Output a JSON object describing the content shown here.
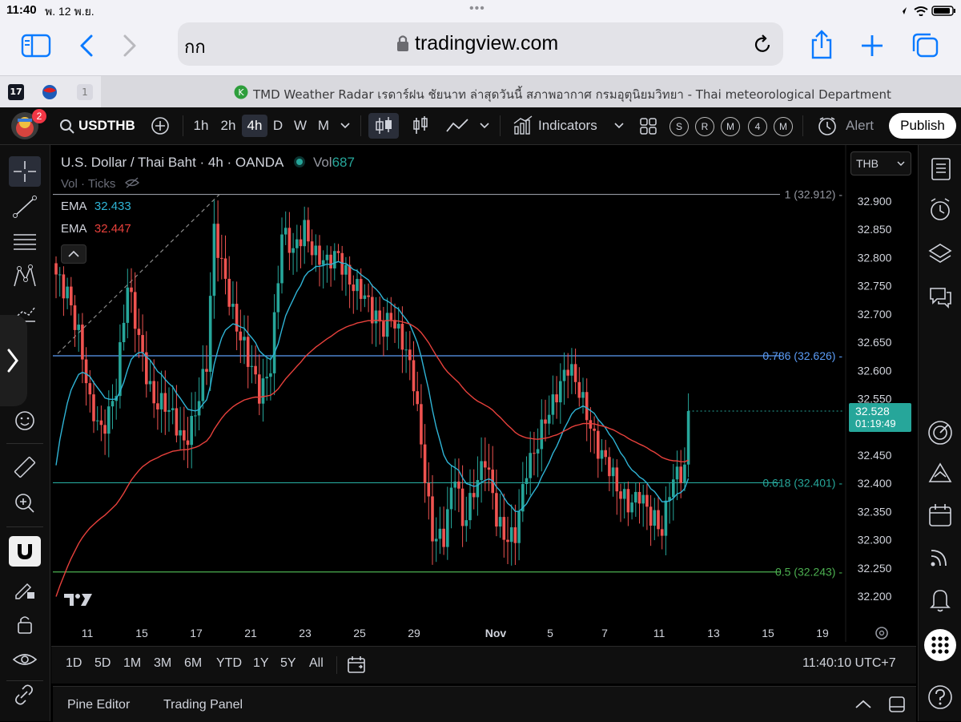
{
  "status": {
    "time": "11:40",
    "date": "พ. 12 พ.ย."
  },
  "safari": {
    "aa": "กก",
    "url": "tradingview.com"
  },
  "tabbar": {
    "tab_count": "1",
    "page_title": "TMD Weather Radar เรดาร์ฝน ชัยนาท ล่าสุดวันนี้ สภาพอากาศ กรมอุตุนิยมวิทยา - Thai meteorological Department"
  },
  "header": {
    "avatar_badge": "2",
    "symbol": "USDTHB",
    "intervals": [
      "1h",
      "2h",
      "4h",
      "D",
      "W",
      "M"
    ],
    "active_interval": "4h",
    "indicators": "Indicators",
    "badges": [
      "S",
      "R",
      "M",
      "4",
      "M"
    ],
    "alert": "Alert",
    "publish": "Publish"
  },
  "legend": {
    "title": "U.S. Dollar / Thai Baht · 4h · OANDA",
    "vol_label": "Vol",
    "vol_value": "687",
    "vol_ticks": "Vol · Ticks",
    "ema1_label": "EMA",
    "ema1_value": "32.433",
    "ema2_label": "EMA",
    "ema2_value": "32.447",
    "currency": "THB"
  },
  "price_badge": {
    "price": "32.528",
    "countdown": "01:19:49"
  },
  "bottom": {
    "ranges": [
      "1D",
      "5D",
      "1M",
      "3M",
      "6M",
      "YTD",
      "1Y",
      "5Y",
      "All"
    ],
    "clock": "11:40:10 UTC+7"
  },
  "panel": {
    "pine": "Pine Editor",
    "trading": "Trading Panel"
  },
  "colors": {
    "up": "#26a69a",
    "down": "#ef5350",
    "ema_fast": "#2fb4d6",
    "ema_slow": "#e8413c",
    "fib_1": "#9598a1",
    "fib_786": "#5b9cf6",
    "fib_618": "#26a69a",
    "fib_5": "#4caf50",
    "bg": "#000000"
  },
  "chart_data": {
    "type": "candlestick",
    "ylim": [
      32.2,
      32.92
    ],
    "y_ticks": [
      "32.900",
      "32.850",
      "32.800",
      "32.750",
      "32.700",
      "32.650",
      "32.600",
      "32.550",
      "32.500",
      "32.450",
      "32.400",
      "32.350",
      "32.300",
      "32.250",
      "32.200"
    ],
    "x_ticks": [
      "11",
      "15",
      "17",
      "21",
      "23",
      "25",
      "29",
      "Nov",
      "5",
      "7",
      "11",
      "13",
      "15",
      "19"
    ],
    "fib_levels": [
      {
        "label": "1 (32.912)",
        "value": 32.912
      },
      {
        "label": "0.786 (32.626)",
        "value": 32.626
      },
      {
        "label": "0.618 (32.401)",
        "value": 32.401
      },
      {
        "label": "0.5 (32.243)",
        "value": 32.243
      }
    ],
    "last_price": 32.528,
    "anchors": [
      [
        0,
        32.77
      ],
      [
        3,
        32.75
      ],
      [
        6,
        32.66
      ],
      [
        9,
        32.53
      ],
      [
        12,
        32.5
      ],
      [
        16,
        32.57
      ],
      [
        19,
        32.74
      ],
      [
        22,
        32.66
      ],
      [
        26,
        32.55
      ],
      [
        30,
        32.52
      ],
      [
        34,
        32.48
      ],
      [
        37,
        32.53
      ],
      [
        40,
        32.6
      ],
      [
        42,
        32.84
      ],
      [
        45,
        32.77
      ],
      [
        48,
        32.68
      ],
      [
        51,
        32.61
      ],
      [
        54,
        32.56
      ],
      [
        57,
        32.62
      ],
      [
        60,
        32.84
      ],
      [
        63,
        32.8
      ],
      [
        66,
        32.86
      ],
      [
        69,
        32.81
      ],
      [
        72,
        32.78
      ],
      [
        75,
        32.8
      ],
      [
        78,
        32.77
      ],
      [
        81,
        32.74
      ],
      [
        84,
        32.69
      ],
      [
        87,
        32.68
      ],
      [
        89,
        32.71
      ],
      [
        92,
        32.65
      ],
      [
        95,
        32.57
      ],
      [
        98,
        32.42
      ],
      [
        100,
        32.32
      ],
      [
        103,
        32.3
      ],
      [
        106,
        32.41
      ],
      [
        108,
        32.33
      ],
      [
        111,
        32.4
      ],
      [
        114,
        32.44
      ],
      [
        117,
        32.33
      ],
      [
        119,
        32.31
      ],
      [
        122,
        32.32
      ],
      [
        125,
        32.42
      ],
      [
        127,
        32.44
      ],
      [
        130,
        32.52
      ],
      [
        133,
        32.57
      ],
      [
        136,
        32.6
      ],
      [
        138,
        32.57
      ],
      [
        141,
        32.53
      ],
      [
        144,
        32.47
      ],
      [
        147,
        32.42
      ],
      [
        149,
        32.38
      ],
      [
        152,
        32.37
      ],
      [
        155,
        32.39
      ],
      [
        158,
        32.33
      ],
      [
        161,
        32.31
      ],
      [
        163,
        32.4
      ],
      [
        165,
        32.43
      ],
      [
        167,
        32.42
      ],
      [
        168,
        32.52
      ]
    ]
  }
}
